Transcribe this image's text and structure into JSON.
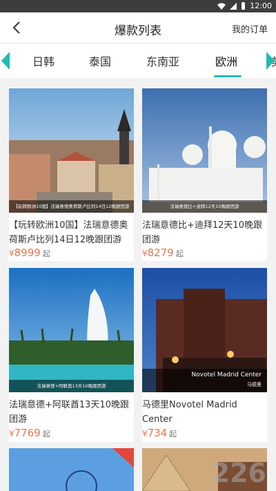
{
  "status": {
    "time": "12:00"
  },
  "header": {
    "title": "爆款列表",
    "my_orders": "我的订单"
  },
  "tabs": [
    "日韩",
    "泰国",
    "东南亚",
    "欧洲",
    "美"
  ],
  "products": [
    {
      "caption": "【玩转欧洲10国】法瑞意德奥荷斯卢比列14日12晚跟团游",
      "title": "【玩转欧洲10国】法瑞意德奥荷斯卢比列14日12晚跟团游",
      "price": "8999",
      "currency": "¥",
      "suffix": "起"
    },
    {
      "caption": "法瑞意德比+迪拜12天10晚跟团游",
      "title": "法瑞意德比+迪拜12天10晚跟团游",
      "price": "8279",
      "currency": "¥",
      "suffix": "起"
    },
    {
      "caption": "法瑞意德+阿联酋13天10晚跟团游",
      "title": "法瑞意德+阿联酋13天10晚跟团游",
      "price": "7769",
      "currency": "¥",
      "suffix": "起"
    },
    {
      "caption": "Novotel Madrid Center",
      "caption2": "马德里",
      "title": "马德里Novotel Madrid Center",
      "price": "734",
      "currency": "¥",
      "suffix": "起"
    }
  ],
  "colors": {
    "accent": "#1ebcb4",
    "price": "#e8774f"
  },
  "watermark": "226"
}
